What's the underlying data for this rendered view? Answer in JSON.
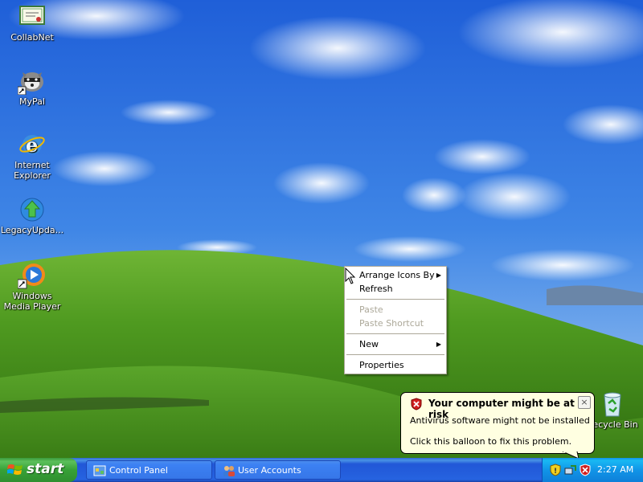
{
  "desktop": {
    "icons": [
      {
        "label": "CollabNet",
        "icon": "certificate-icon"
      },
      {
        "label": "MyPal",
        "icon": "raccoon-icon"
      },
      {
        "label": "Internet Explorer",
        "icon": "internet-explorer-icon"
      },
      {
        "label": "LegacyUpda...",
        "icon": "globe-arrow-icon"
      },
      {
        "label": "Windows Media Player",
        "icon": "media-player-icon"
      },
      {
        "label": "Recycle Bin",
        "icon": "recycle-bin-icon"
      }
    ]
  },
  "context_menu": {
    "items": [
      {
        "label": "Arrange Icons By",
        "submenu": true,
        "enabled": true
      },
      {
        "label": "Refresh",
        "submenu": false,
        "enabled": true
      },
      {
        "label": "Paste",
        "submenu": false,
        "enabled": false
      },
      {
        "label": "Paste Shortcut",
        "submenu": false,
        "enabled": false
      },
      {
        "label": "New",
        "submenu": true,
        "enabled": true
      },
      {
        "label": "Properties",
        "submenu": false,
        "enabled": true
      }
    ]
  },
  "balloon": {
    "title": "Your computer might be at risk",
    "line1": "Antivirus software might not be installed",
    "line2": "Click this balloon to fix this problem.",
    "close": "×"
  },
  "taskbar": {
    "start_label": "start",
    "buttons": [
      {
        "label": "Control Panel",
        "icon": "control-panel-icon"
      },
      {
        "label": "User Accounts",
        "icon": "user-accounts-icon"
      }
    ],
    "clock": "2:27 AM"
  },
  "colors": {
    "taskbar_blue": "#2663e0",
    "start_green": "#37a137",
    "balloon_bg": "#ffffe1",
    "menu_disabled": "#aca899"
  }
}
